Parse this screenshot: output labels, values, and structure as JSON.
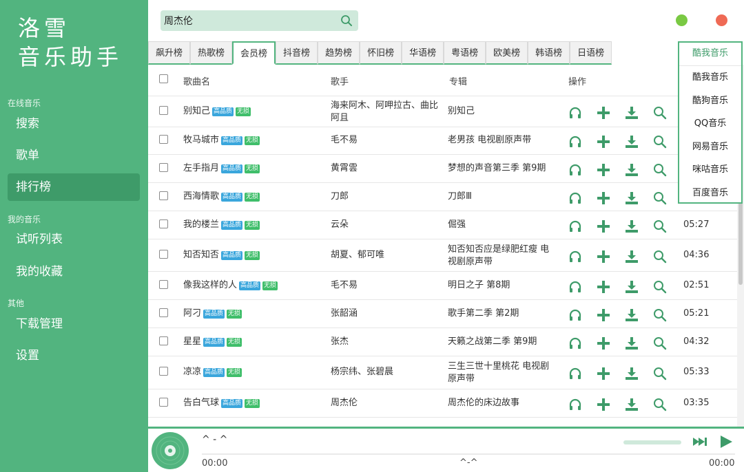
{
  "app": {
    "logo_line1": "洛雪",
    "logo_line2": "音乐助手"
  },
  "sidebar": {
    "sections": [
      {
        "title": "在线音乐",
        "items": [
          "搜索",
          "歌单",
          "排行榜"
        ]
      },
      {
        "title": "我的音乐",
        "items": [
          "试听列表",
          "我的收藏"
        ]
      },
      {
        "title": "其他",
        "items": [
          "下载管理",
          "设置"
        ]
      }
    ],
    "active_item": "排行榜"
  },
  "search": {
    "value": "周杰伦",
    "icon": "search-icon"
  },
  "window_controls": {
    "minimize_color": "#7ac943",
    "close_color": "#ef6a55"
  },
  "tabs": [
    "飙升榜",
    "热歌榜",
    "会员榜",
    "抖音榜",
    "趋势榜",
    "怀旧榜",
    "华语榜",
    "粤语榜",
    "欧美榜",
    "韩语榜",
    "日语榜"
  ],
  "active_tab": "会员榜",
  "source": {
    "current": "酷我音乐",
    "options": [
      "酷我音乐",
      "酷狗音乐",
      "QQ音乐",
      "网易音乐",
      "咪咕音乐",
      "百度音乐"
    ]
  },
  "table": {
    "headers": {
      "name": "歌曲名",
      "artist": "歌手",
      "album": "专辑",
      "ops": "操作"
    },
    "badge_hq": "高品质",
    "badge_lossless": "无损",
    "rows": [
      {
        "name": "别知己",
        "artist": "海来阿木、阿呷拉古、曲比阿且",
        "album": "别知己",
        "duration": ""
      },
      {
        "name": "牧马城市",
        "artist": "毛不易",
        "album": "老男孩 电视剧原声带",
        "duration": ""
      },
      {
        "name": "左手指月",
        "artist": "黄霄雲",
        "album": "梦想的声音第三季 第9期",
        "duration": ""
      },
      {
        "name": "西海情歌",
        "artist": "刀郎",
        "album": "刀郎Ⅲ",
        "duration": ""
      },
      {
        "name": "我的楼兰",
        "artist": "云朵",
        "album": "倔强",
        "duration": "05:27"
      },
      {
        "name": "知否知否",
        "artist": "胡夏、郁可唯",
        "album": "知否知否应是绿肥红瘦 电视剧原声带",
        "duration": "04:36"
      },
      {
        "name": "像我这样的人",
        "artist": "毛不易",
        "album": "明日之子 第8期",
        "duration": "02:51"
      },
      {
        "name": "阿刁",
        "artist": "张韶涵",
        "album": "歌手第二季 第2期",
        "duration": "05:21"
      },
      {
        "name": "星星",
        "artist": "张杰",
        "album": "天籁之战第二季 第9期",
        "duration": "04:32"
      },
      {
        "name": "凉凉",
        "artist": "杨宗纬、张碧晨",
        "album": "三生三世十里桃花 电视剧原声带",
        "duration": "05:33"
      },
      {
        "name": "告白气球",
        "artist": "周杰伦",
        "album": "周杰伦的床边故事",
        "duration": "03:35"
      }
    ]
  },
  "player": {
    "title": "^ - ^",
    "current_time": "00:00",
    "total_time": "00:00",
    "lyric": "^-^"
  },
  "colors": {
    "accent": "#52b47f",
    "accent_dark": "#3e9b69",
    "badge_hq": "#3aa6dc",
    "badge_lossless": "#3fbe6a"
  }
}
